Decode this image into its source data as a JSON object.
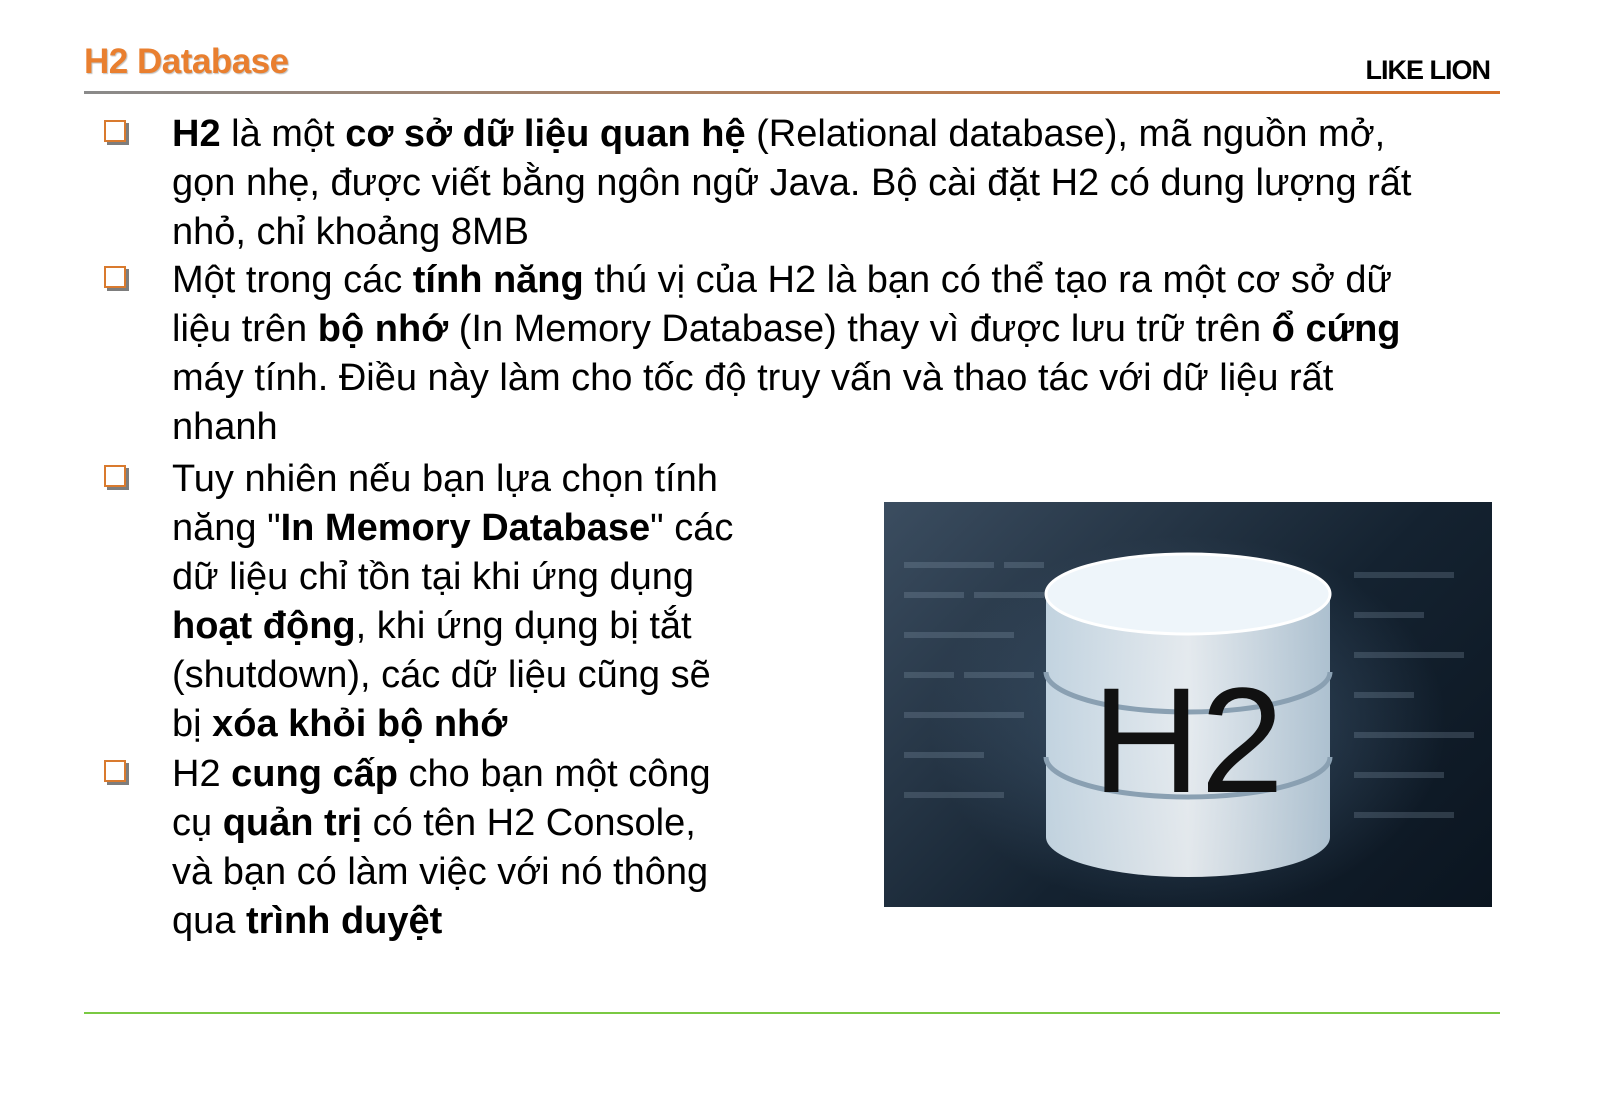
{
  "header": {
    "title": "H2 Database",
    "brand": "LIKE LION"
  },
  "bullets": [
    {
      "segments": [
        {
          "t": "H2",
          "b": true
        },
        {
          "t": " là một ",
          "b": false
        },
        {
          "t": "cơ sở dữ liệu quan hệ",
          "b": true
        },
        {
          "t": " (Relational database), mã nguồn mở,\ngọn nhẹ, được viết bằng ngôn ngữ Java. Bộ cài đặt H2 có dung lượng rất\nnhỏ, chỉ khoảng 8MB",
          "b": false
        }
      ]
    },
    {
      "segments": [
        {
          "t": "Một trong các ",
          "b": false
        },
        {
          "t": "tính năng",
          "b": true
        },
        {
          "t": " thú vị của H2 là bạn có thể tạo ra một cơ sở dữ\nliệu trên ",
          "b": false
        },
        {
          "t": "bộ nhớ",
          "b": true
        },
        {
          "t": " (In Memory Database) thay vì được lưu trữ trên ",
          "b": false
        },
        {
          "t": "ổ cứng",
          "b": true
        },
        {
          "t": "\nmáy tính. Điều này làm cho tốc độ truy vấn và thao tác với dữ liệu rất\nnhanh",
          "b": false
        }
      ]
    },
    {
      "segments": [
        {
          "t": "Tuy nhiên nếu bạn lựa chọn tính\nnăng \"",
          "b": false
        },
        {
          "t": "In Memory Database",
          "b": true
        },
        {
          "t": "\" các\ndữ liệu chỉ tồn tại khi ứng dụng\n",
          "b": false
        },
        {
          "t": "hoạt động",
          "b": true
        },
        {
          "t": ", khi ứng dụng bị tắt\n(shutdown), các dữ liệu cũng sẽ\nbị ",
          "b": false
        },
        {
          "t": "xóa khỏi bộ nhớ",
          "b": true
        }
      ]
    },
    {
      "segments": [
        {
          "t": "H2 ",
          "b": false
        },
        {
          "t": "cung cấp",
          "b": true
        },
        {
          "t": " cho bạn một công\ncụ ",
          "b": false
        },
        {
          "t": "quản trị",
          "b": true
        },
        {
          "t": " có tên H2 Console,\nvà bạn có làm việc với nó thông\nqua ",
          "b": false
        },
        {
          "t": "trình duyệt",
          "b": true
        }
      ]
    }
  ],
  "illustration": {
    "label": "H2",
    "icon": "database-cylinder-icon",
    "colors": {
      "accent": "#e97f2f",
      "rule_bottom": "#7ac943",
      "bullet_border": "#d97a2e"
    }
  }
}
